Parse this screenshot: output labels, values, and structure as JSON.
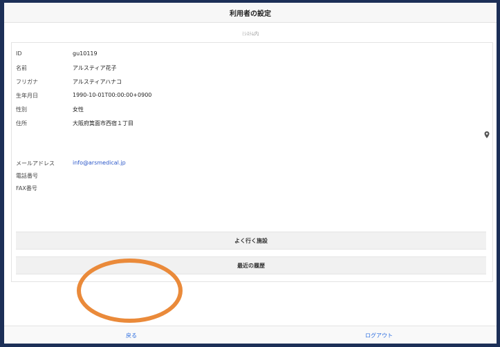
{
  "header": {
    "title": "利用者の設定"
  },
  "subheader": {
    "text": "ﾐｼｽﾃﾑ内"
  },
  "profile": {
    "fields": [
      {
        "label": "ID",
        "value": "gu10119"
      },
      {
        "label": "名前",
        "value": "アルスティア花子"
      },
      {
        "label": "フリガナ",
        "value": "アルスティアハナコ"
      },
      {
        "label": "生年月日",
        "value": "1990-10-01T00:00:00+0900"
      },
      {
        "label": "性別",
        "value": "女性"
      },
      {
        "label": "住所",
        "value": "大阪府箕面市西宿１丁目"
      },
      {
        "label": "メールアドレス",
        "value": "info@arsmedical.jp"
      },
      {
        "label": "電話番号",
        "value": ""
      },
      {
        "label": "FAX番号",
        "value": ""
      }
    ],
    "map_icon": "map-pin-icon"
  },
  "actions": {
    "frequent_label": "よく行く施設",
    "recent_label": "最近の履歴"
  },
  "bottom": {
    "left_label": "戻る",
    "right_label": "ログアウト"
  },
  "annotation": {
    "color": "#ea8a3a"
  }
}
